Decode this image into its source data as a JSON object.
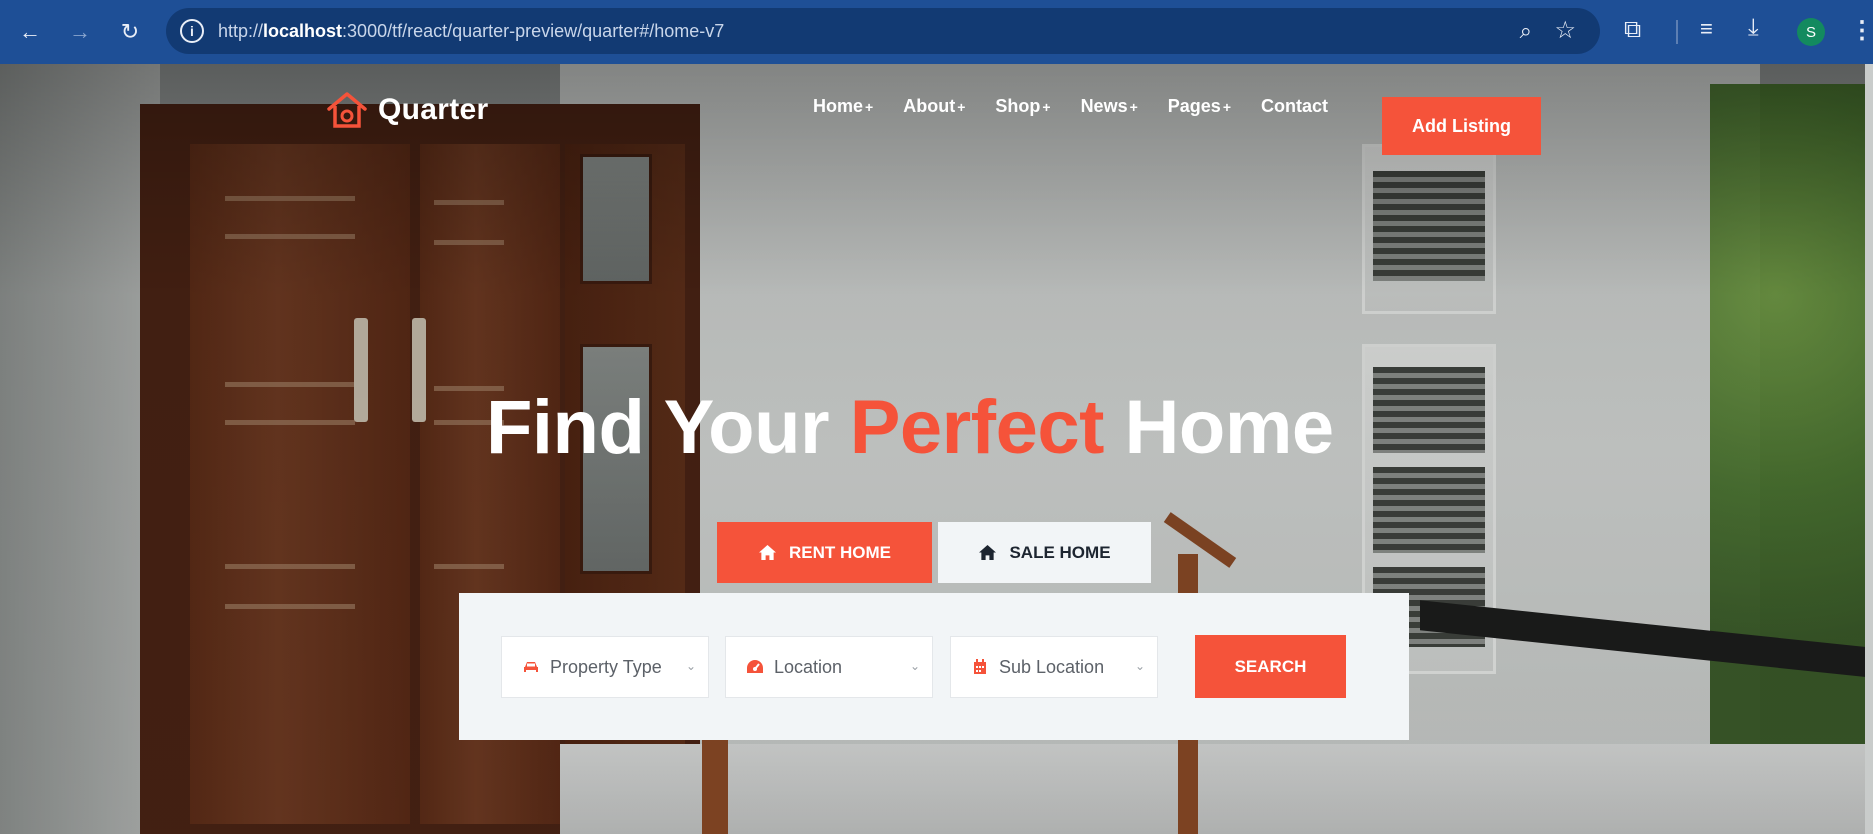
{
  "browser": {
    "url_prefix": "http://",
    "url_host": "localhost",
    "url_rest": ":3000/tf/react/quarter-preview/quarter#/home-v7",
    "profile_initial": "S",
    "icons": [
      "back-icon",
      "forward-icon",
      "reload-icon",
      "site-info-icon",
      "zoom-icon",
      "bookmark-star-icon",
      "extensions-icon",
      "media-control-icon",
      "download-icon",
      "profile-avatar",
      "menu-icon"
    ]
  },
  "header": {
    "logo_text": "Quarter",
    "nav": [
      {
        "label": "Home",
        "has_submenu": true,
        "marker": "+"
      },
      {
        "label": "About",
        "has_submenu": true,
        "marker": "+"
      },
      {
        "label": "Shop",
        "has_submenu": true,
        "marker": "+"
      },
      {
        "label": "News",
        "has_submenu": true,
        "marker": "+"
      },
      {
        "label": "Pages",
        "has_submenu": true,
        "marker": "+"
      },
      {
        "label": "Contact",
        "has_submenu": false,
        "marker": ""
      }
    ],
    "cta_label": "Add Listing"
  },
  "hero": {
    "headline_part1": "Find Your ",
    "headline_accent": "Perfect",
    "headline_part2": " Home",
    "tabs": [
      {
        "label": "RENT HOME",
        "active": true
      },
      {
        "label": "SALE HOME",
        "active": false
      }
    ]
  },
  "search": {
    "property_type": "Property Type",
    "location": "Location",
    "sub_location": "Sub Location",
    "button_label": "SEARCH"
  },
  "colors": {
    "accent": "#f5533a",
    "browser_bar": "#1e4f96",
    "panel": "#f2f5f7"
  }
}
